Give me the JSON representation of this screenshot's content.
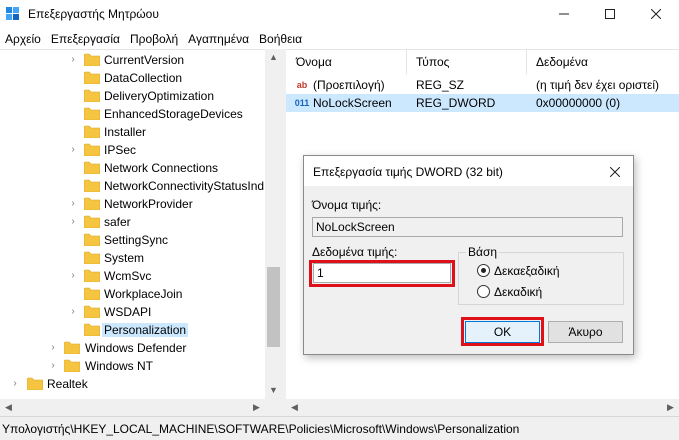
{
  "window": {
    "title": "Επεξεργαστής Μητρώου",
    "icon": "regedit-icon",
    "controls": {
      "minimize": "minimize-icon",
      "maximize": "maximize-icon",
      "close": "close-icon"
    }
  },
  "menu": [
    "Αρχείο",
    "Επεξεργασία",
    "Προβολή",
    "Αγαπημένα",
    "Βοήθεια"
  ],
  "tree": {
    "items": [
      {
        "label": "CurrentVersion",
        "expandable": true
      },
      {
        "label": "DataCollection",
        "expandable": false
      },
      {
        "label": "DeliveryOptimization",
        "expandable": false
      },
      {
        "label": "EnhancedStorageDevices",
        "expandable": false
      },
      {
        "label": "Installer",
        "expandable": false
      },
      {
        "label": "IPSec",
        "expandable": true
      },
      {
        "label": "Network Connections",
        "expandable": false
      },
      {
        "label": "NetworkConnectivityStatusInd",
        "expandable": false
      },
      {
        "label": "NetworkProvider",
        "expandable": true
      },
      {
        "label": "safer",
        "expandable": true
      },
      {
        "label": "SettingSync",
        "expandable": false
      },
      {
        "label": "System",
        "expandable": false
      },
      {
        "label": "WcmSvc",
        "expandable": true
      },
      {
        "label": "WorkplaceJoin",
        "expandable": false
      },
      {
        "label": "WSDAPI",
        "expandable": true
      },
      {
        "label": "Personalization",
        "expandable": false,
        "selected": true
      }
    ],
    "parent_items": [
      {
        "label": "Windows Defender",
        "expandable": true
      },
      {
        "label": "Windows NT",
        "expandable": true
      }
    ],
    "root_items": [
      {
        "label": "Realtek",
        "expandable": true
      }
    ]
  },
  "list": {
    "columns": [
      "Όνομα",
      "Τύπος",
      "Δεδομένα"
    ],
    "rows": [
      {
        "icon": "string-value-icon",
        "name": "(Προεπιλογή)",
        "type": "REG_SZ",
        "data": "(η τιμή δεν έχει οριστεί)",
        "selected": false
      },
      {
        "icon": "binary-value-icon",
        "name": "NoLockScreen",
        "type": "REG_DWORD",
        "data": "0x00000000 (0)",
        "selected": true
      }
    ]
  },
  "status": {
    "path": "Υπολογιστής\\HKEY_LOCAL_MACHINE\\SOFTWARE\\Policies\\Microsoft\\Windows\\Personalization"
  },
  "dialog": {
    "title": "Επεξεργασία τιμής DWORD (32 bit)",
    "value_name_label": "Όνομα τιμής:",
    "value_name": "NoLockScreen",
    "value_data_label": "Δεδομένα τιμής:",
    "value_data": "1",
    "base_label": "Βάση",
    "base_options": [
      "Δεκαεξαδική",
      "Δεκαδική"
    ],
    "base_selected": "Δεκαεξαδική",
    "ok_label": "OK",
    "cancel_label": "Άκυρο"
  },
  "colors": {
    "highlight_box": "#e0101a",
    "selection": "#cce8ff",
    "folder": "#f5c542"
  }
}
